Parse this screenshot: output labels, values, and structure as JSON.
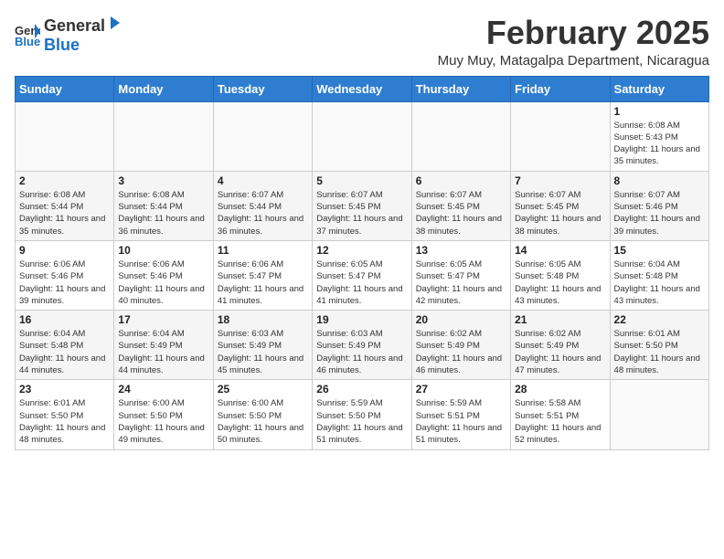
{
  "header": {
    "logo_general": "General",
    "logo_blue": "Blue",
    "month_title": "February 2025",
    "location": "Muy Muy, Matagalpa Department, Nicaragua"
  },
  "days_of_week": [
    "Sunday",
    "Monday",
    "Tuesday",
    "Wednesday",
    "Thursday",
    "Friday",
    "Saturday"
  ],
  "weeks": [
    [
      {
        "day": "",
        "sunrise": "",
        "sunset": "",
        "daylight": ""
      },
      {
        "day": "",
        "sunrise": "",
        "sunset": "",
        "daylight": ""
      },
      {
        "day": "",
        "sunrise": "",
        "sunset": "",
        "daylight": ""
      },
      {
        "day": "",
        "sunrise": "",
        "sunset": "",
        "daylight": ""
      },
      {
        "day": "",
        "sunrise": "",
        "sunset": "",
        "daylight": ""
      },
      {
        "day": "",
        "sunrise": "",
        "sunset": "",
        "daylight": ""
      },
      {
        "day": "1",
        "sunrise": "Sunrise: 6:08 AM",
        "sunset": "Sunset: 5:43 PM",
        "daylight": "Daylight: 11 hours and 35 minutes."
      }
    ],
    [
      {
        "day": "2",
        "sunrise": "Sunrise: 6:08 AM",
        "sunset": "Sunset: 5:44 PM",
        "daylight": "Daylight: 11 hours and 35 minutes."
      },
      {
        "day": "3",
        "sunrise": "Sunrise: 6:08 AM",
        "sunset": "Sunset: 5:44 PM",
        "daylight": "Daylight: 11 hours and 36 minutes."
      },
      {
        "day": "4",
        "sunrise": "Sunrise: 6:07 AM",
        "sunset": "Sunset: 5:44 PM",
        "daylight": "Daylight: 11 hours and 36 minutes."
      },
      {
        "day": "5",
        "sunrise": "Sunrise: 6:07 AM",
        "sunset": "Sunset: 5:45 PM",
        "daylight": "Daylight: 11 hours and 37 minutes."
      },
      {
        "day": "6",
        "sunrise": "Sunrise: 6:07 AM",
        "sunset": "Sunset: 5:45 PM",
        "daylight": "Daylight: 11 hours and 38 minutes."
      },
      {
        "day": "7",
        "sunrise": "Sunrise: 6:07 AM",
        "sunset": "Sunset: 5:45 PM",
        "daylight": "Daylight: 11 hours and 38 minutes."
      },
      {
        "day": "8",
        "sunrise": "Sunrise: 6:07 AM",
        "sunset": "Sunset: 5:46 PM",
        "daylight": "Daylight: 11 hours and 39 minutes."
      }
    ],
    [
      {
        "day": "9",
        "sunrise": "Sunrise: 6:06 AM",
        "sunset": "Sunset: 5:46 PM",
        "daylight": "Daylight: 11 hours and 39 minutes."
      },
      {
        "day": "10",
        "sunrise": "Sunrise: 6:06 AM",
        "sunset": "Sunset: 5:46 PM",
        "daylight": "Daylight: 11 hours and 40 minutes."
      },
      {
        "day": "11",
        "sunrise": "Sunrise: 6:06 AM",
        "sunset": "Sunset: 5:47 PM",
        "daylight": "Daylight: 11 hours and 41 minutes."
      },
      {
        "day": "12",
        "sunrise": "Sunrise: 6:05 AM",
        "sunset": "Sunset: 5:47 PM",
        "daylight": "Daylight: 11 hours and 41 minutes."
      },
      {
        "day": "13",
        "sunrise": "Sunrise: 6:05 AM",
        "sunset": "Sunset: 5:47 PM",
        "daylight": "Daylight: 11 hours and 42 minutes."
      },
      {
        "day": "14",
        "sunrise": "Sunrise: 6:05 AM",
        "sunset": "Sunset: 5:48 PM",
        "daylight": "Daylight: 11 hours and 43 minutes."
      },
      {
        "day": "15",
        "sunrise": "Sunrise: 6:04 AM",
        "sunset": "Sunset: 5:48 PM",
        "daylight": "Daylight: 11 hours and 43 minutes."
      }
    ],
    [
      {
        "day": "16",
        "sunrise": "Sunrise: 6:04 AM",
        "sunset": "Sunset: 5:48 PM",
        "daylight": "Daylight: 11 hours and 44 minutes."
      },
      {
        "day": "17",
        "sunrise": "Sunrise: 6:04 AM",
        "sunset": "Sunset: 5:49 PM",
        "daylight": "Daylight: 11 hours and 44 minutes."
      },
      {
        "day": "18",
        "sunrise": "Sunrise: 6:03 AM",
        "sunset": "Sunset: 5:49 PM",
        "daylight": "Daylight: 11 hours and 45 minutes."
      },
      {
        "day": "19",
        "sunrise": "Sunrise: 6:03 AM",
        "sunset": "Sunset: 5:49 PM",
        "daylight": "Daylight: 11 hours and 46 minutes."
      },
      {
        "day": "20",
        "sunrise": "Sunrise: 6:02 AM",
        "sunset": "Sunset: 5:49 PM",
        "daylight": "Daylight: 11 hours and 46 minutes."
      },
      {
        "day": "21",
        "sunrise": "Sunrise: 6:02 AM",
        "sunset": "Sunset: 5:49 PM",
        "daylight": "Daylight: 11 hours and 47 minutes."
      },
      {
        "day": "22",
        "sunrise": "Sunrise: 6:01 AM",
        "sunset": "Sunset: 5:50 PM",
        "daylight": "Daylight: 11 hours and 48 minutes."
      }
    ],
    [
      {
        "day": "23",
        "sunrise": "Sunrise: 6:01 AM",
        "sunset": "Sunset: 5:50 PM",
        "daylight": "Daylight: 11 hours and 48 minutes."
      },
      {
        "day": "24",
        "sunrise": "Sunrise: 6:00 AM",
        "sunset": "Sunset: 5:50 PM",
        "daylight": "Daylight: 11 hours and 49 minutes."
      },
      {
        "day": "25",
        "sunrise": "Sunrise: 6:00 AM",
        "sunset": "Sunset: 5:50 PM",
        "daylight": "Daylight: 11 hours and 50 minutes."
      },
      {
        "day": "26",
        "sunrise": "Sunrise: 5:59 AM",
        "sunset": "Sunset: 5:50 PM",
        "daylight": "Daylight: 11 hours and 51 minutes."
      },
      {
        "day": "27",
        "sunrise": "Sunrise: 5:59 AM",
        "sunset": "Sunset: 5:51 PM",
        "daylight": "Daylight: 11 hours and 51 minutes."
      },
      {
        "day": "28",
        "sunrise": "Sunrise: 5:58 AM",
        "sunset": "Sunset: 5:51 PM",
        "daylight": "Daylight: 11 hours and 52 minutes."
      },
      {
        "day": "",
        "sunrise": "",
        "sunset": "",
        "daylight": ""
      }
    ]
  ]
}
